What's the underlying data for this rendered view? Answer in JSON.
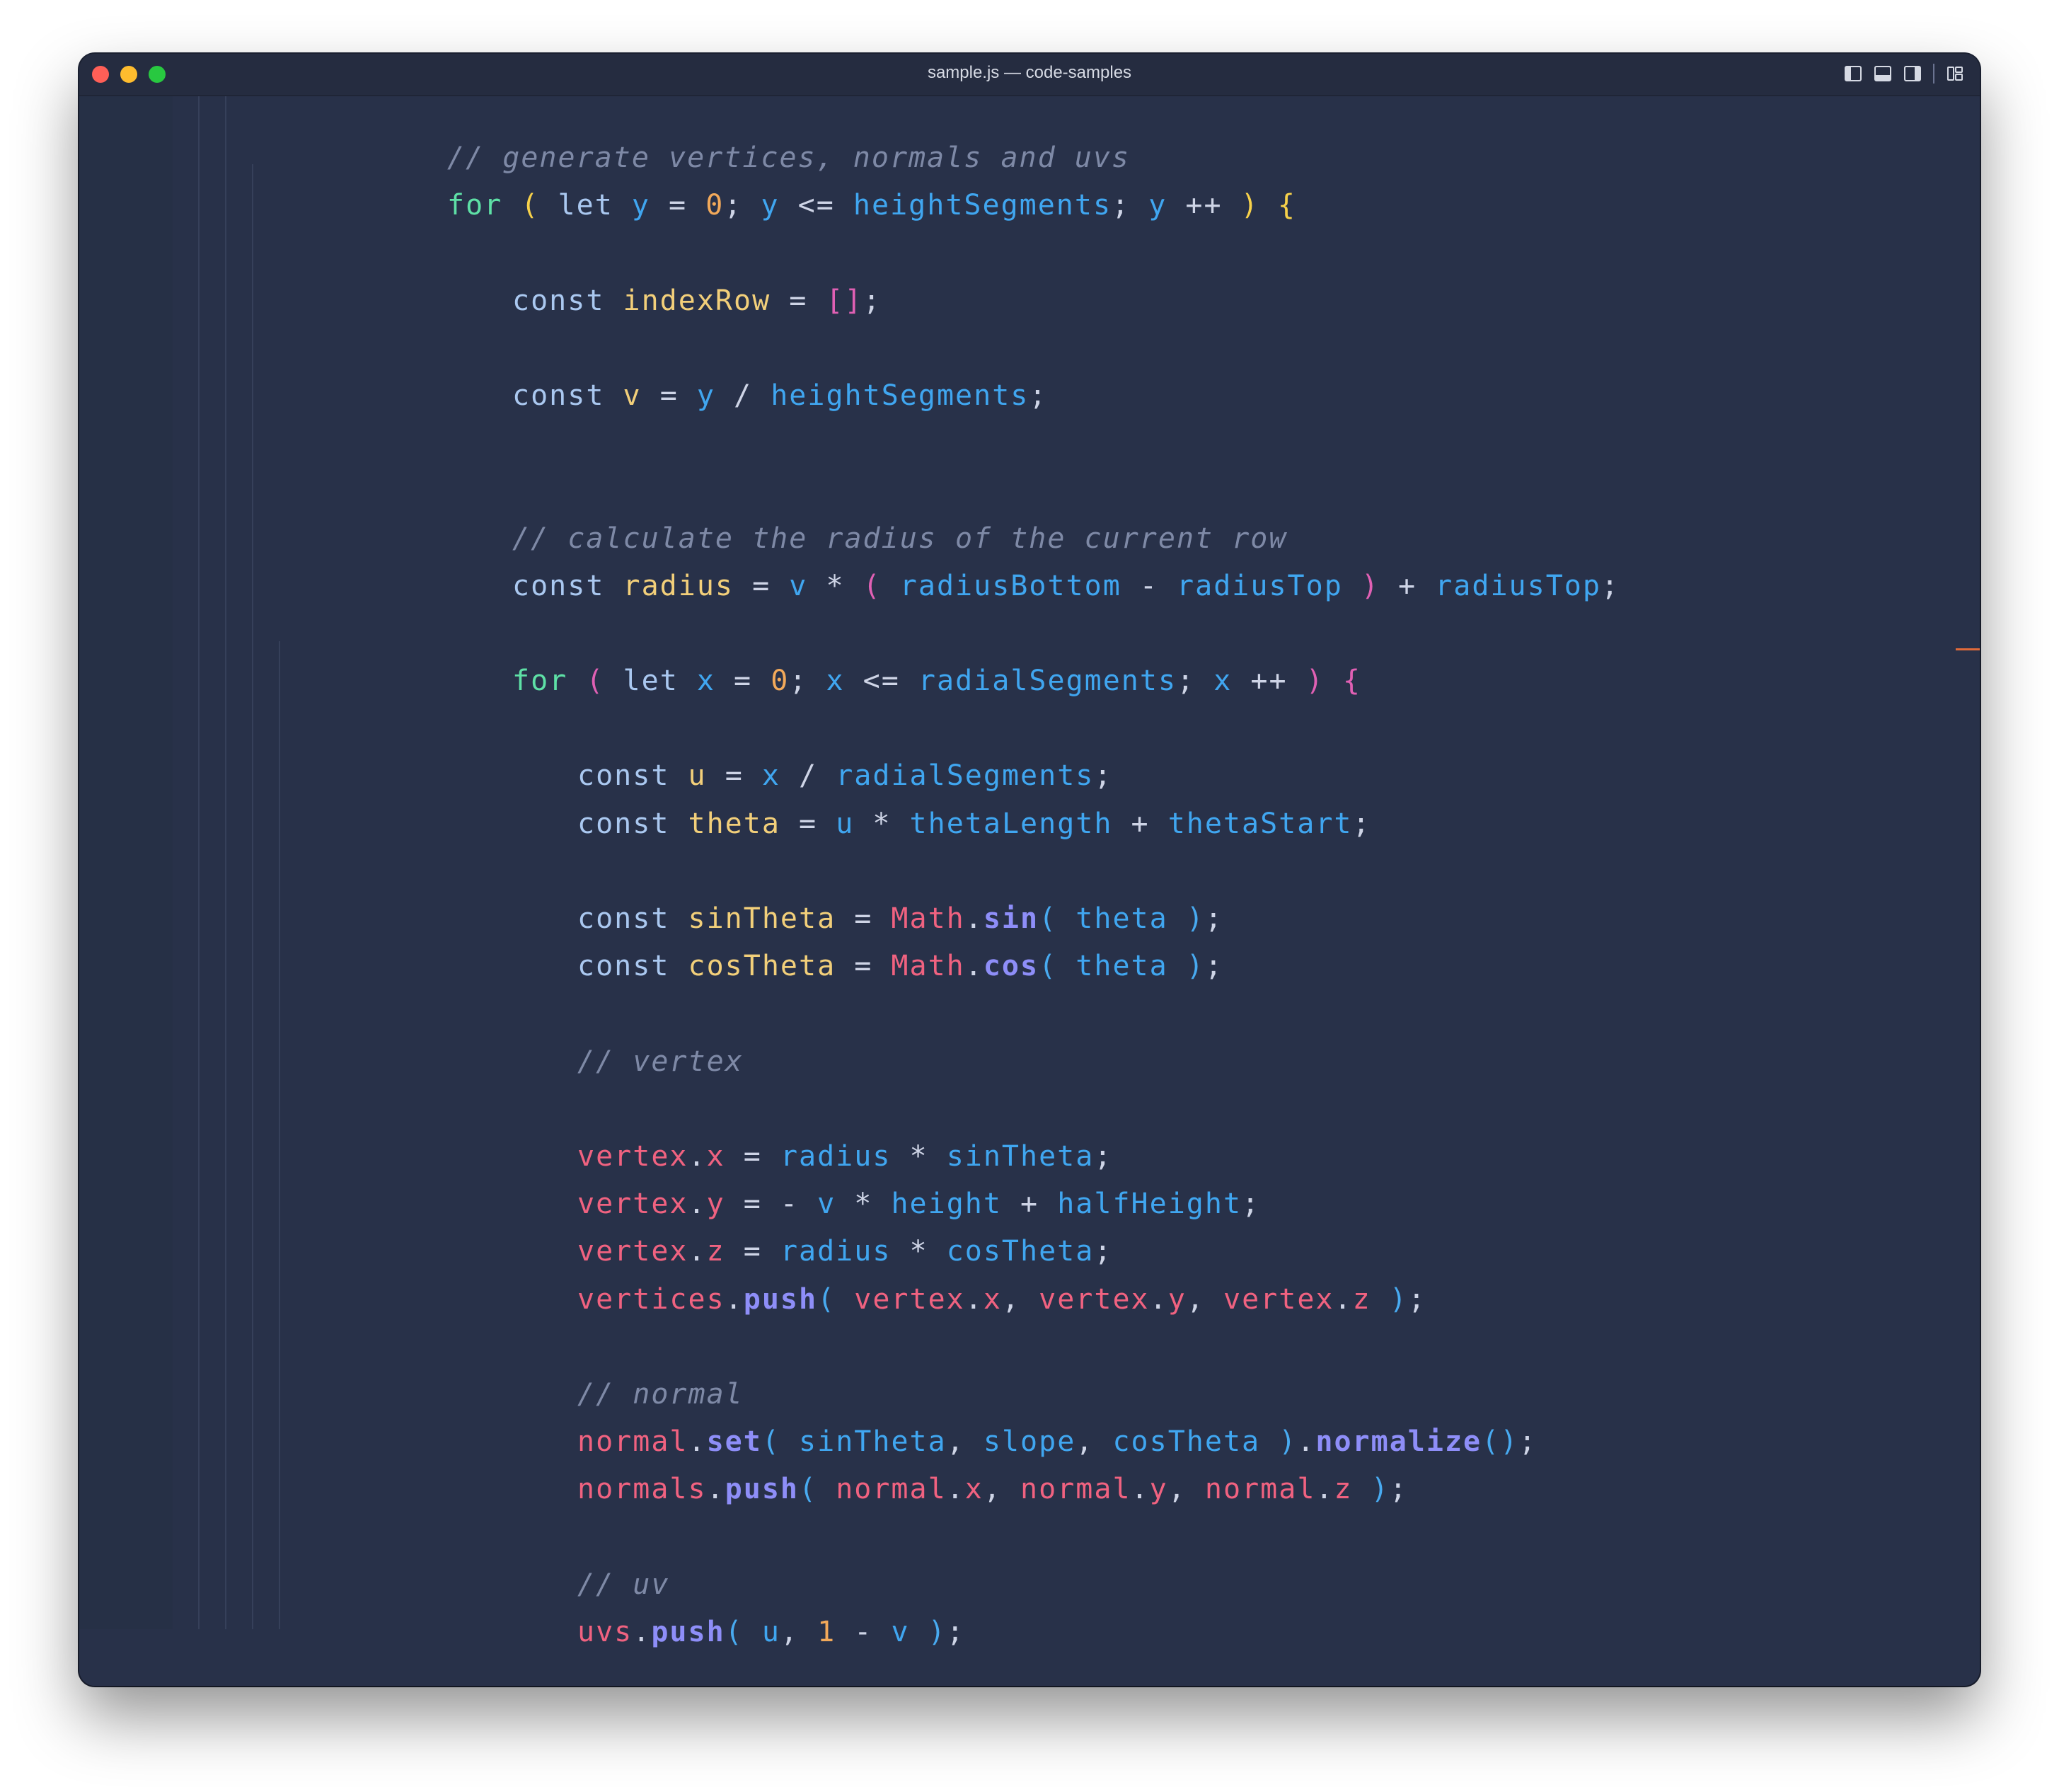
{
  "window": {
    "title": "sample.js — code-samples"
  },
  "titlebar_icons": [
    "toggle-primary-sidebar-icon",
    "toggle-panel-icon",
    "toggle-secondary-sidebar-icon",
    "customize-layout-icon"
  ],
  "colors": {
    "background": "#283149",
    "comment": "#7e89a6",
    "keyword_for": "#5ee0a6",
    "keyword": "#aac8f0",
    "variable": "#40a6f0",
    "declaration": "#f2cf7a",
    "number": "#f2a95a",
    "bracket_gold": "#f7d14a",
    "bracket_pink": "#e060b4",
    "bracket_blue": "#48aaf0",
    "object": "#f06280",
    "method": "#8e8ef8",
    "operator": "#ced4e6"
  },
  "lines": [
    {
      "indent": 2,
      "tokens": [
        {
          "t": "// generate vertices, normals and uvs",
          "c": "comment"
        }
      ]
    },
    {
      "indent": 2,
      "tokens": [
        {
          "t": "for",
          "c": "kwfor"
        },
        {
          "t": " "
        },
        {
          "t": "(",
          "c": "bgold"
        },
        {
          "t": " "
        },
        {
          "t": "let",
          "c": "kw"
        },
        {
          "t": " "
        },
        {
          "t": "y",
          "c": "var"
        },
        {
          "t": " = ",
          "c": "op"
        },
        {
          "t": "0",
          "c": "num"
        },
        {
          "t": "; ",
          "c": "op"
        },
        {
          "t": "y",
          "c": "var"
        },
        {
          "t": " <= ",
          "c": "op"
        },
        {
          "t": "heightSegments",
          "c": "var"
        },
        {
          "t": "; ",
          "c": "op"
        },
        {
          "t": "y",
          "c": "var"
        },
        {
          "t": " ++ ",
          "c": "op"
        },
        {
          "t": ")",
          "c": "bgold"
        },
        {
          "t": " "
        },
        {
          "t": "{",
          "c": "bgold"
        }
      ]
    },
    {
      "indent": 3,
      "tokens": []
    },
    {
      "indent": 3,
      "tokens": [
        {
          "t": "const",
          "c": "kw"
        },
        {
          "t": " "
        },
        {
          "t": "indexRow",
          "c": "decl"
        },
        {
          "t": " = ",
          "c": "op"
        },
        {
          "t": "[]",
          "c": "bpink"
        },
        {
          "t": ";",
          "c": "op"
        }
      ]
    },
    {
      "indent": 3,
      "tokens": []
    },
    {
      "indent": 3,
      "tokens": [
        {
          "t": "const",
          "c": "kw"
        },
        {
          "t": " "
        },
        {
          "t": "v",
          "c": "decl"
        },
        {
          "t": " = ",
          "c": "op"
        },
        {
          "t": "y",
          "c": "var"
        },
        {
          "t": " / ",
          "c": "op"
        },
        {
          "t": "heightSegments",
          "c": "var"
        },
        {
          "t": ";",
          "c": "op"
        }
      ]
    },
    {
      "indent": 3,
      "tokens": []
    },
    {
      "indent": 3,
      "tokens": []
    },
    {
      "indent": 3,
      "tokens": [
        {
          "t": "// calculate the radius of the current row",
          "c": "comment"
        }
      ]
    },
    {
      "indent": 3,
      "tokens": [
        {
          "t": "const",
          "c": "kw"
        },
        {
          "t": " "
        },
        {
          "t": "radius",
          "c": "decl"
        },
        {
          "t": " = ",
          "c": "op"
        },
        {
          "t": "v",
          "c": "var"
        },
        {
          "t": " * ",
          "c": "op"
        },
        {
          "t": "(",
          "c": "bpink"
        },
        {
          "t": " "
        },
        {
          "t": "radiusBottom",
          "c": "var"
        },
        {
          "t": " - ",
          "c": "op"
        },
        {
          "t": "radiusTop",
          "c": "var"
        },
        {
          "t": " "
        },
        {
          "t": ")",
          "c": "bpink"
        },
        {
          "t": " + ",
          "c": "op"
        },
        {
          "t": "radiusTop",
          "c": "var"
        },
        {
          "t": ";",
          "c": "op"
        }
      ]
    },
    {
      "indent": 3,
      "tokens": []
    },
    {
      "indent": 3,
      "tokens": [
        {
          "t": "for",
          "c": "kwfor"
        },
        {
          "t": " "
        },
        {
          "t": "(",
          "c": "bpink"
        },
        {
          "t": " "
        },
        {
          "t": "let",
          "c": "kw"
        },
        {
          "t": " "
        },
        {
          "t": "x",
          "c": "var"
        },
        {
          "t": " = ",
          "c": "op"
        },
        {
          "t": "0",
          "c": "num"
        },
        {
          "t": "; ",
          "c": "op"
        },
        {
          "t": "x",
          "c": "var"
        },
        {
          "t": " <= ",
          "c": "op"
        },
        {
          "t": "radialSegments",
          "c": "var"
        },
        {
          "t": "; ",
          "c": "op"
        },
        {
          "t": "x",
          "c": "var"
        },
        {
          "t": " ++ ",
          "c": "op"
        },
        {
          "t": ")",
          "c": "bpink"
        },
        {
          "t": " "
        },
        {
          "t": "{",
          "c": "bpink"
        }
      ]
    },
    {
      "indent": 4,
      "tokens": []
    },
    {
      "indent": 4,
      "tokens": [
        {
          "t": "const",
          "c": "kw"
        },
        {
          "t": " "
        },
        {
          "t": "u",
          "c": "decl"
        },
        {
          "t": " = ",
          "c": "op"
        },
        {
          "t": "x",
          "c": "var"
        },
        {
          "t": " / ",
          "c": "op"
        },
        {
          "t": "radialSegments",
          "c": "var"
        },
        {
          "t": ";",
          "c": "op"
        }
      ]
    },
    {
      "indent": 4,
      "tokens": [
        {
          "t": "const",
          "c": "kw"
        },
        {
          "t": " "
        },
        {
          "t": "theta",
          "c": "decl"
        },
        {
          "t": " = ",
          "c": "op"
        },
        {
          "t": "u",
          "c": "var"
        },
        {
          "t": " * ",
          "c": "op"
        },
        {
          "t": "thetaLength",
          "c": "var"
        },
        {
          "t": " + ",
          "c": "op"
        },
        {
          "t": "thetaStart",
          "c": "var"
        },
        {
          "t": ";",
          "c": "op"
        }
      ]
    },
    {
      "indent": 4,
      "tokens": []
    },
    {
      "indent": 4,
      "tokens": [
        {
          "t": "const",
          "c": "kw"
        },
        {
          "t": " "
        },
        {
          "t": "sinTheta",
          "c": "decl"
        },
        {
          "t": " = ",
          "c": "op"
        },
        {
          "t": "Math",
          "c": "obj"
        },
        {
          "t": ".",
          "c": "op"
        },
        {
          "t": "sin",
          "c": "meth"
        },
        {
          "t": "(",
          "c": "bblue"
        },
        {
          "t": " "
        },
        {
          "t": "theta",
          "c": "var"
        },
        {
          "t": " "
        },
        {
          "t": ")",
          "c": "bblue"
        },
        {
          "t": ";",
          "c": "op"
        }
      ]
    },
    {
      "indent": 4,
      "tokens": [
        {
          "t": "const",
          "c": "kw"
        },
        {
          "t": " "
        },
        {
          "t": "cosTheta",
          "c": "decl"
        },
        {
          "t": " = ",
          "c": "op"
        },
        {
          "t": "Math",
          "c": "obj"
        },
        {
          "t": ".",
          "c": "op"
        },
        {
          "t": "cos",
          "c": "meth"
        },
        {
          "t": "(",
          "c": "bblue"
        },
        {
          "t": " "
        },
        {
          "t": "theta",
          "c": "var"
        },
        {
          "t": " "
        },
        {
          "t": ")",
          "c": "bblue"
        },
        {
          "t": ";",
          "c": "op"
        }
      ]
    },
    {
      "indent": 4,
      "tokens": []
    },
    {
      "indent": 4,
      "tokens": [
        {
          "t": "// vertex",
          "c": "comment"
        }
      ]
    },
    {
      "indent": 4,
      "tokens": []
    },
    {
      "indent": 4,
      "tokens": [
        {
          "t": "vertex",
          "c": "obj"
        },
        {
          "t": ".",
          "c": "op"
        },
        {
          "t": "x",
          "c": "obj"
        },
        {
          "t": " = ",
          "c": "op"
        },
        {
          "t": "radius",
          "c": "var"
        },
        {
          "t": " * ",
          "c": "op"
        },
        {
          "t": "sinTheta",
          "c": "var"
        },
        {
          "t": ";",
          "c": "op"
        }
      ]
    },
    {
      "indent": 4,
      "tokens": [
        {
          "t": "vertex",
          "c": "obj"
        },
        {
          "t": ".",
          "c": "op"
        },
        {
          "t": "y",
          "c": "obj"
        },
        {
          "t": " = - ",
          "c": "op"
        },
        {
          "t": "v",
          "c": "var"
        },
        {
          "t": " * ",
          "c": "op"
        },
        {
          "t": "height",
          "c": "var"
        },
        {
          "t": " + ",
          "c": "op"
        },
        {
          "t": "halfHeight",
          "c": "var"
        },
        {
          "t": ";",
          "c": "op"
        }
      ]
    },
    {
      "indent": 4,
      "tokens": [
        {
          "t": "vertex",
          "c": "obj"
        },
        {
          "t": ".",
          "c": "op"
        },
        {
          "t": "z",
          "c": "obj"
        },
        {
          "t": " = ",
          "c": "op"
        },
        {
          "t": "radius",
          "c": "var"
        },
        {
          "t": " * ",
          "c": "op"
        },
        {
          "t": "cosTheta",
          "c": "var"
        },
        {
          "t": ";",
          "c": "op"
        }
      ]
    },
    {
      "indent": 4,
      "tokens": [
        {
          "t": "vertices",
          "c": "obj"
        },
        {
          "t": ".",
          "c": "op"
        },
        {
          "t": "push",
          "c": "meth"
        },
        {
          "t": "(",
          "c": "bblue"
        },
        {
          "t": " "
        },
        {
          "t": "vertex",
          "c": "obj"
        },
        {
          "t": ".",
          "c": "op"
        },
        {
          "t": "x",
          "c": "obj"
        },
        {
          "t": ", ",
          "c": "op"
        },
        {
          "t": "vertex",
          "c": "obj"
        },
        {
          "t": ".",
          "c": "op"
        },
        {
          "t": "y",
          "c": "obj"
        },
        {
          "t": ", ",
          "c": "op"
        },
        {
          "t": "vertex",
          "c": "obj"
        },
        {
          "t": ".",
          "c": "op"
        },
        {
          "t": "z",
          "c": "obj"
        },
        {
          "t": " "
        },
        {
          "t": ")",
          "c": "bblue"
        },
        {
          "t": ";",
          "c": "op"
        }
      ]
    },
    {
      "indent": 4,
      "tokens": []
    },
    {
      "indent": 4,
      "tokens": [
        {
          "t": "// normal",
          "c": "comment"
        }
      ]
    },
    {
      "indent": 4,
      "tokens": [
        {
          "t": "normal",
          "c": "obj"
        },
        {
          "t": ".",
          "c": "op"
        },
        {
          "t": "set",
          "c": "meth"
        },
        {
          "t": "(",
          "c": "bblue"
        },
        {
          "t": " "
        },
        {
          "t": "sinTheta",
          "c": "var"
        },
        {
          "t": ", ",
          "c": "op"
        },
        {
          "t": "slope",
          "c": "var"
        },
        {
          "t": ", ",
          "c": "op"
        },
        {
          "t": "cosTheta",
          "c": "var"
        },
        {
          "t": " "
        },
        {
          "t": ")",
          "c": "bblue"
        },
        {
          "t": ".",
          "c": "op"
        },
        {
          "t": "normalize",
          "c": "meth"
        },
        {
          "t": "()",
          "c": "bblue"
        },
        {
          "t": ";",
          "c": "op"
        }
      ]
    },
    {
      "indent": 4,
      "tokens": [
        {
          "t": "normals",
          "c": "obj"
        },
        {
          "t": ".",
          "c": "op"
        },
        {
          "t": "push",
          "c": "meth"
        },
        {
          "t": "(",
          "c": "bblue"
        },
        {
          "t": " "
        },
        {
          "t": "normal",
          "c": "obj"
        },
        {
          "t": ".",
          "c": "op"
        },
        {
          "t": "x",
          "c": "obj"
        },
        {
          "t": ", ",
          "c": "op"
        },
        {
          "t": "normal",
          "c": "obj"
        },
        {
          "t": ".",
          "c": "op"
        },
        {
          "t": "y",
          "c": "obj"
        },
        {
          "t": ", ",
          "c": "op"
        },
        {
          "t": "normal",
          "c": "obj"
        },
        {
          "t": ".",
          "c": "op"
        },
        {
          "t": "z",
          "c": "obj"
        },
        {
          "t": " "
        },
        {
          "t": ")",
          "c": "bblue"
        },
        {
          "t": ";",
          "c": "op"
        }
      ]
    },
    {
      "indent": 4,
      "tokens": []
    },
    {
      "indent": 4,
      "tokens": [
        {
          "t": "// uv",
          "c": "comment"
        }
      ]
    },
    {
      "indent": 4,
      "tokens": [
        {
          "t": "uvs",
          "c": "obj"
        },
        {
          "t": ".",
          "c": "op"
        },
        {
          "t": "push",
          "c": "meth"
        },
        {
          "t": "(",
          "c": "bblue"
        },
        {
          "t": " "
        },
        {
          "t": "u",
          "c": "var"
        },
        {
          "t": ", ",
          "c": "op"
        },
        {
          "t": "1",
          "c": "num"
        },
        {
          "t": " - ",
          "c": "op"
        },
        {
          "t": "v",
          "c": "var"
        },
        {
          "t": " "
        },
        {
          "t": ")",
          "c": "bblue"
        },
        {
          "t": ";",
          "c": "op"
        }
      ]
    }
  ]
}
